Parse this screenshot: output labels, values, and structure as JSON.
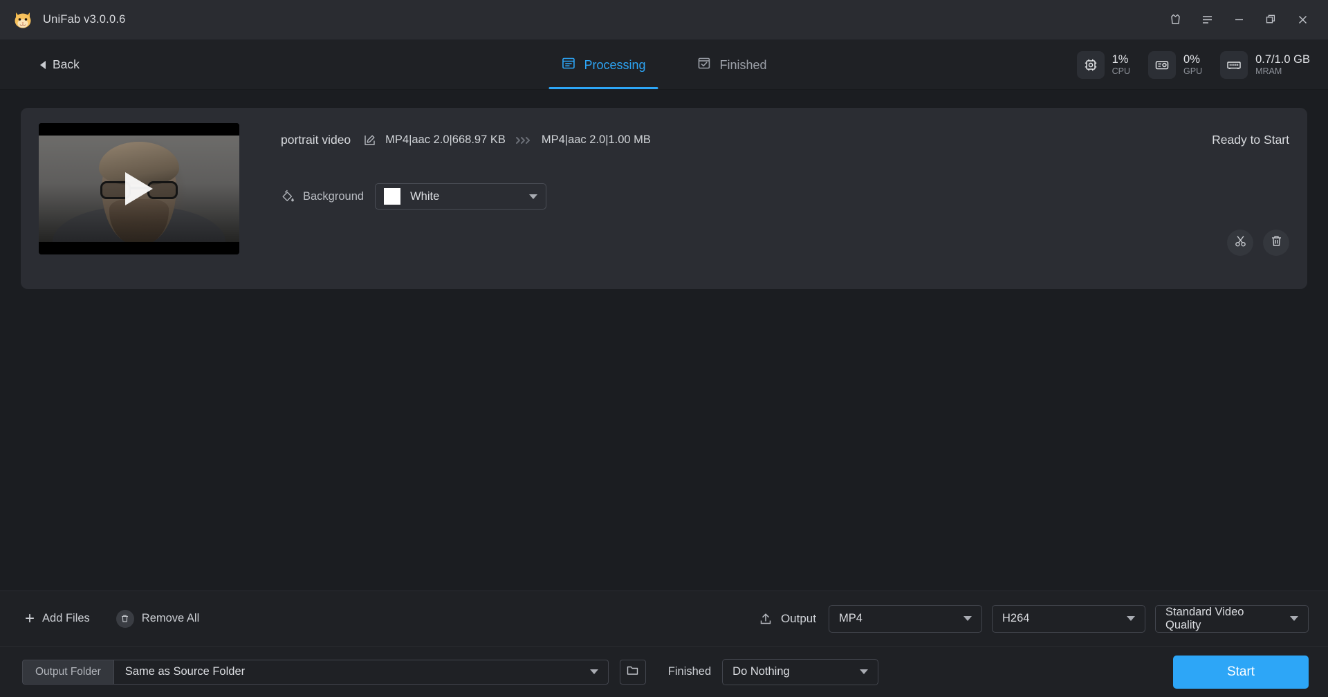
{
  "window": {
    "app_title": "UniFab v3.0.0.6",
    "logo_icon": "cat-logo-icon",
    "controls": [
      {
        "name": "gift-icon",
        "label": ""
      },
      {
        "name": "menu-icon",
        "label": ""
      },
      {
        "name": "minimize-icon",
        "label": ""
      },
      {
        "name": "maximize-icon",
        "label": ""
      },
      {
        "name": "close-icon",
        "label": ""
      }
    ]
  },
  "nav": {
    "back_label": "Back",
    "tabs": [
      {
        "label": "Processing",
        "icon": "list-panel-icon",
        "active": true
      },
      {
        "label": "Finished",
        "icon": "checkbox-icon",
        "active": false
      }
    ],
    "system_monitor": [
      {
        "id": "cpu",
        "icon": "cpu-icon",
        "value": "1%",
        "label": "CPU"
      },
      {
        "id": "gpu",
        "icon": "gpu-icon",
        "value": "0%",
        "label": "GPU"
      },
      {
        "id": "mram",
        "icon": "ram-icon",
        "value": "0.7/1.0 GB",
        "label": "MRAM"
      }
    ]
  },
  "job": {
    "thumbnail_alt": "portrait video preview",
    "play_icon": "play-icon",
    "name": "portrait video",
    "edit_icon": "edit-icon",
    "source_format": "MP4|aac 2.0|668.97 KB",
    "arrow_icon": "triple-chevron-right-icon",
    "target_format": "MP4|aac 2.0|1.00 MB",
    "status": "Ready to Start",
    "background": {
      "icon": "paint-bucket-icon",
      "label": "Background",
      "value": "White",
      "swatch_color": "#ffffff"
    },
    "actions": [
      {
        "name": "trim-button",
        "icon": "scissors-icon"
      },
      {
        "name": "delete-button",
        "icon": "trash-icon"
      }
    ]
  },
  "toolbar": {
    "add_files_label": "Add Files",
    "add_files_icon": "plus-icon",
    "remove_all_label": "Remove All",
    "remove_all_icon": "trash-icon",
    "output_label": "Output",
    "output_icon": "upload-icon",
    "format_value": "MP4",
    "codec_value": "H264",
    "quality_value": "Standard Video Quality"
  },
  "statusbar": {
    "output_folder_label": "Output Folder",
    "output_folder_value": "Same as Source Folder",
    "browse_icon": "folder-icon",
    "finished_label": "Finished",
    "finished_action_value": "Do Nothing",
    "start_label": "Start"
  },
  "colors": {
    "accent": "#2da6f7",
    "page_bg": "#1b1d21",
    "card_bg": "#2b2d33",
    "titlebar_bg": "#2a2c31"
  }
}
